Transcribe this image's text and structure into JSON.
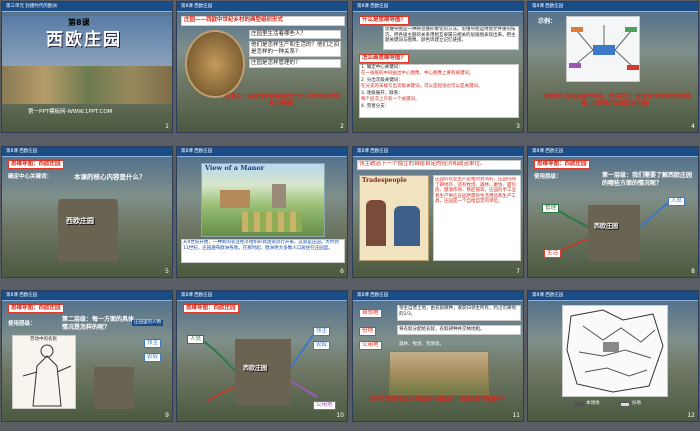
{
  "slides": [
    {
      "number": "1",
      "header": "第三单元 封建时代的欧洲",
      "lesson": "第8课",
      "title": "西欧庄园",
      "footer": "第一PPT模板网-WWW.1PPT.COM"
    },
    {
      "number": "2",
      "header": "第8课 西欧庄园",
      "heading": "庄园——西欧中世纪乡村的典型组织形式",
      "questions": [
        "庄园里生活着哪些人？",
        "他们是怎样生产和生活的？他们之间是怎样的一种关系？",
        "庄园是怎样管理的？"
      ],
      "note": "让我们一起通过思维导图的方式认识中世纪的西欧庄园吧！"
    },
    {
      "number": "3",
      "header": "第8课 西欧庄园",
      "q1": "什么是思维导图？",
      "a1": "思维导图是一种将思维形象化的方法。思维导图运用图文并重的技巧，把各级主题的关系用相互隶属与相关的层级图表现出来，把主题关键词与图像、颜色等建立记忆链接。",
      "q2": "怎么画思维导图？",
      "steps": [
        "1. 确定中心关键词：",
        "在一张纸的中间画出中心图像，中心图像上要有关键词。",
        "2. 分出次级关键词：",
        "在分支的末端写出次级关键词，可以是短语也可以是关键词。",
        "3. 逐级展开，联系：",
        "每个层次上只有一个关键词。",
        "4. 完善分支："
      ]
    },
    {
      "number": "4",
      "header": "第8课 西欧庄园",
      "label": "示例：",
      "note": "请同学们先阅读课文内容，然后我们一起来完成本课的思维导图，构建我们的知识结构吧！"
    },
    {
      "number": "5",
      "header": "第8课 西欧庄园",
      "heading": "思维导图：西欧庄园",
      "step": "确定中心关键词：",
      "question": "本课的核心内容是什么？",
      "center": "西欧庄园"
    },
    {
      "number": "6",
      "header": "第8课 西欧庄园",
      "poster": "View of a Manor",
      "caption": "从9世纪开始，一种新的农业经济组织形式逐渐流行开来，这就是庄园。大约到11世纪，庄园遍布欧洲各地。在那时起，欧洲绝大多数人口居住在庄园里。"
    },
    {
      "number": "7",
      "header": "第8课 西欧庄园",
      "topline": "领主统治下一个独立的自给自足的经济和政治单位。",
      "book": "Tradespeople",
      "text": "庄园的农业生产是相对封闭的，庄园内除了耕地外，还有牧场、森林、磨坊、面包房、酿酒作坊、铁匠铺等，庄园的手工业者生产供应庄园所需的生活用品和生产工具，庄园是一个自给自足的单位。"
    },
    {
      "number": "8",
      "header": "第8课 西欧庄园",
      "heading": "思维导图：西欧庄园",
      "method": "使用层级：",
      "question": "第一层级：我们需要了解西欧庄园的哪些方面的情况呢？",
      "center": "西欧庄园",
      "labels": [
        "管理",
        "生活",
        "人员"
      ]
    },
    {
      "number": "9",
      "header": "第8课 西欧庄园",
      "heading": "思维导图：西欧庄园",
      "method": "使用层级：",
      "question": "第二层级：每一方面的具体情况是怎样的呢？",
      "callout": "庄园里的人物",
      "caption": "劳动中的农民",
      "labels": [
        "领主",
        "农奴"
      ]
    },
    {
      "number": "10",
      "header": "第8课 西欧庄园",
      "heading": "思维导图：西欧庄园",
      "labels": [
        "领主",
        "农奴",
        "公用地",
        "人员"
      ],
      "center": "西欧庄园"
    },
    {
      "number": "11",
      "header": "第8课 西欧庄园",
      "tags": [
        "自领地",
        "份地",
        "公用地"
      ],
      "lines": [
        "领主自营土地，由农奴耕种，收获归领主所有，约占可耕地的1/3。",
        "将农奴分配给农奴，农奴耕种并交纳地租。",
        "森林、牧场、荒地等。"
      ],
      "note": "同学们观察书本自己绘制一幅欧洲中世纪庄园平面图吧？"
    },
    {
      "number": "12",
      "header": "第8课 西欧庄园",
      "legend": [
        "本领地",
        "份地"
      ]
    }
  ]
}
